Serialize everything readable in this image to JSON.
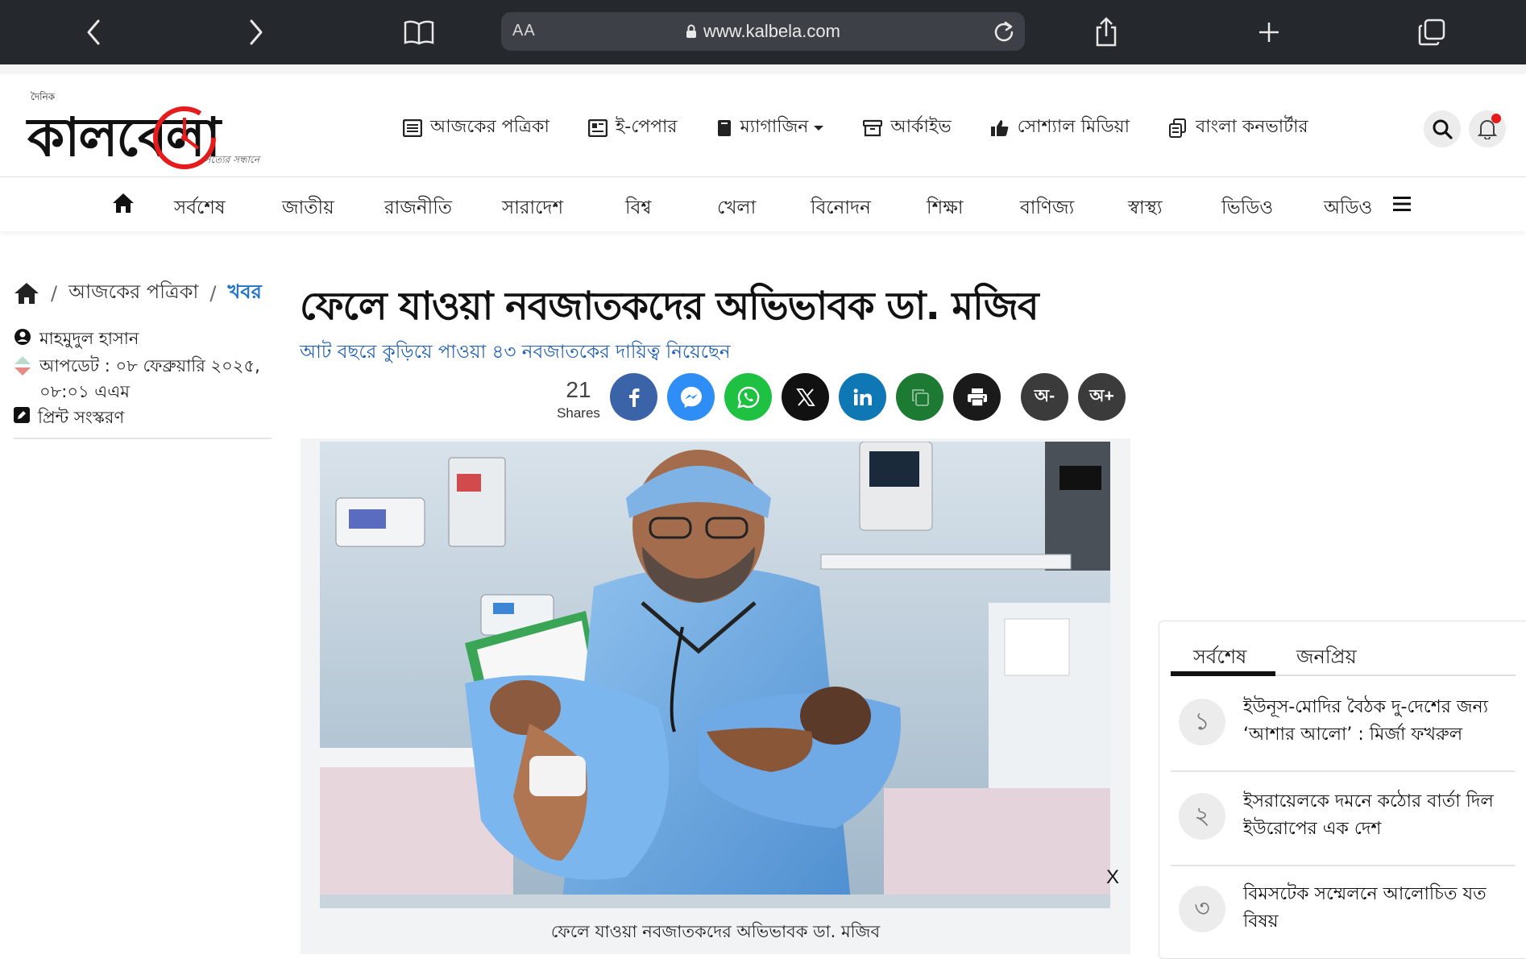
{
  "browser": {
    "aa_label": "AA",
    "url": "www.kalbela.com"
  },
  "header": {
    "logo_small": "দৈনিক",
    "logo_text": "কালবেলা",
    "logo_tagline": "সত্যের সন্ধানে",
    "nav": [
      {
        "label": "আজকের পত্রিকা",
        "icon": "newspaper-icon"
      },
      {
        "label": "ই-পেপার",
        "icon": "epaper-icon"
      },
      {
        "label": "ম্যাগাজিন",
        "icon": "book-icon"
      },
      {
        "label": "আর্কাইভ",
        "icon": "archive-icon"
      },
      {
        "label": "সোশ্যাল মিডিয়া",
        "icon": "thumbs-up-icon"
      },
      {
        "label": "বাংলা কনভার্টার",
        "icon": "converter-icon"
      }
    ]
  },
  "categories": [
    "সর্বশেষ",
    "জাতীয়",
    "রাজনীতি",
    "সারাদেশ",
    "বিশ্ব",
    "খেলা",
    "বিনোদন",
    "শিক্ষা",
    "বাণিজ্য",
    "স্বাস্থ্য",
    "ভিডিও",
    "অডিও"
  ],
  "breadcrumb": {
    "sep": "/",
    "level1": "আজকের পত্রিকা",
    "level2": "খবর"
  },
  "meta": {
    "author": "মাহমুদুল হাসান",
    "updated_line1": "আপডেট : ০৮ ফেব্রুয়ারি ২০২৫,",
    "updated_line2": "০৮:০১ এএম",
    "print_label": "প্রিন্ট সংস্করণ"
  },
  "article": {
    "headline": "ফেলে যাওয়া নবজাতকদের অভিভাবক ডা. মজিব",
    "subhead": "আট বছরে কুড়িয়ে পাওয়া ৪৩ নবজাতকের দায়িত্ব নিয়েছেন",
    "share_count": "21",
    "share_label": "Shares",
    "font_minus": "অ-",
    "font_plus": "অ+",
    "photo_close": "X",
    "caption": "ফেলে যাওয়া নবজাতকদের অভিভাবক ডা. মজিব",
    "share_colors": {
      "facebook": "#3b64a8",
      "messenger": "#2f8ef5",
      "whatsapp": "#1fc142",
      "x": "#111111",
      "linkedin": "#1077b5",
      "copy": "#1d7a32",
      "print": "#1a1a1a",
      "font": "#3b3b3b"
    }
  },
  "sidebar": {
    "tabs": [
      "সর্বশেষ",
      "জনপ্রিয়"
    ],
    "items": [
      {
        "num": "১",
        "text": "ইউনূস-মোদির বৈঠক দু-দেশের জন্য ‘আশার আলো’ : মির্জা ফখরুল"
      },
      {
        "num": "২",
        "text": "ইসরায়েলকে দমনে কঠোর বার্তা দিল ইউরোপের এক দেশ"
      },
      {
        "num": "৩",
        "text": "বিমসটেক সম্মেলনে আলোচিত যত বিষয়"
      }
    ]
  },
  "theme": {
    "chrome_bg": "#25282c",
    "link_blue": "#1f74c9",
    "accent_red": "#e61b1b"
  }
}
